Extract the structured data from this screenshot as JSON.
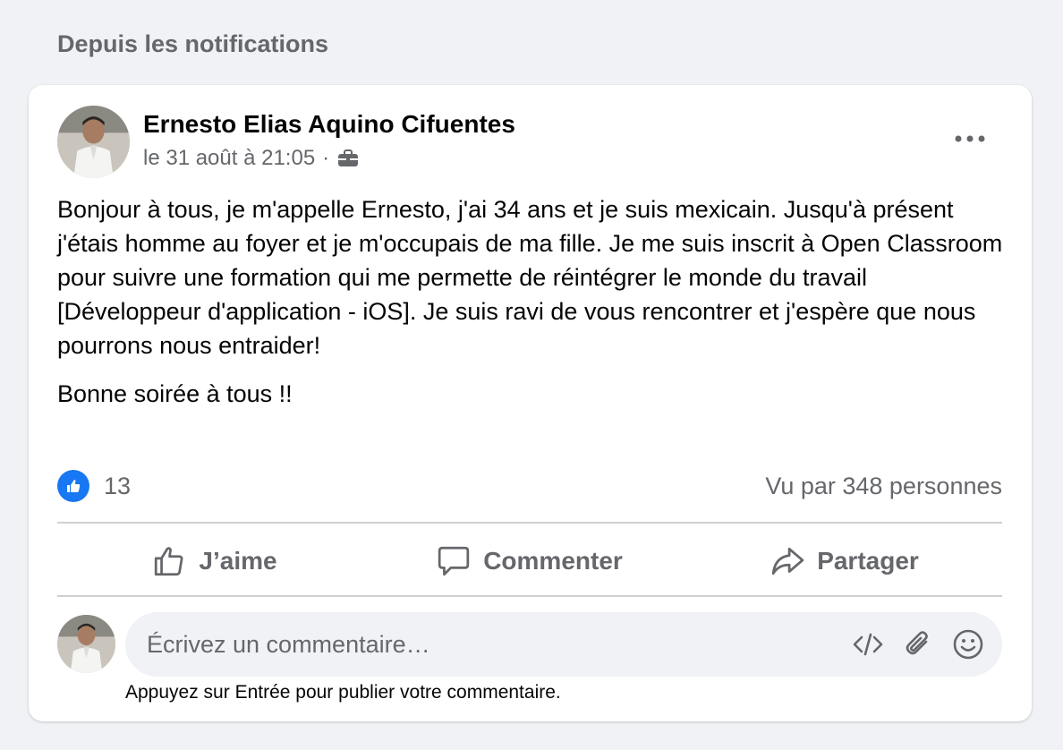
{
  "section": {
    "title": "Depuis les notifications"
  },
  "post": {
    "author": "Ernesto Elias Aquino Cifuentes",
    "timestamp": "le 31 août à 21:05",
    "separator": "·",
    "privacy_icon": "briefcase-icon",
    "body": [
      "Bonjour à tous, je m'appelle Ernesto, j'ai 34 ans et je suis mexicain. Jusqu'à présent j'étais homme au foyer et je m'occupais de ma fille. Je me suis inscrit à Open Classroom pour suivre une formation qui me permette de réintégrer le monde du travail [Développeur d'application - iOS]. Je suis ravi de vous rencontrer et j'espère que nous pourrons nous entraider!",
      "Bonne soirée à tous !!"
    ],
    "reaction_count": "13",
    "seen_by": "Vu par 348 personnes"
  },
  "actions": {
    "like_label": "J’aime",
    "comment_label": "Commenter",
    "share_label": "Partager"
  },
  "comment": {
    "placeholder": "Écrivez un commentaire…",
    "hint": "Appuyez sur Entrée pour publier votre commentaire."
  },
  "colors": {
    "accent": "#1877f2",
    "secondary_text": "#65676b",
    "divider": "#ced0d4",
    "input_bg": "#f0f2f5"
  }
}
